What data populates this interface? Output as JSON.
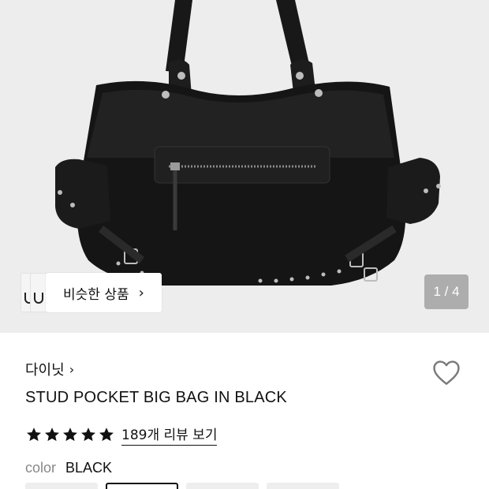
{
  "gallery": {
    "similar_button_label": "비슷한 상품",
    "similar_button_chevron": "›",
    "counter": "1 / 4",
    "current": 1,
    "total": 4
  },
  "product": {
    "brand": "다이닛",
    "brand_chevron": "›",
    "title": "STUD POCKET BIG BAG IN BLACK",
    "rating": 5,
    "review_link": "189개 리뷰 보기",
    "color_label": "color",
    "color_value": "BLACK",
    "swatch_count": 4,
    "selected_swatch": 2
  },
  "icons": {
    "wishlist": "heart-icon",
    "star": "star-icon",
    "similar_chevron": "chevron-right-icon"
  },
  "colors": {
    "hero_bg": "#ededed",
    "bag": "#1a1a1a",
    "text": "#111111",
    "muted": "#888888"
  }
}
